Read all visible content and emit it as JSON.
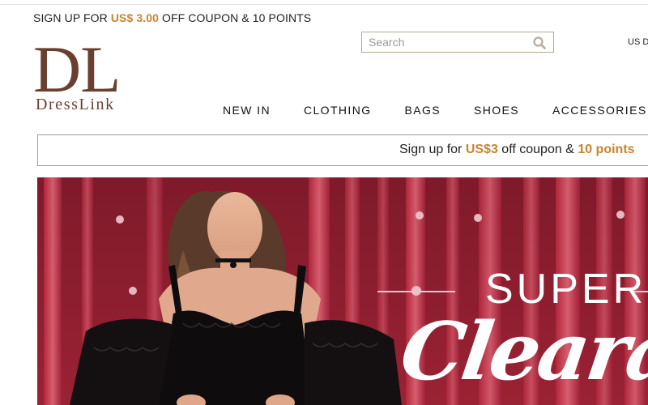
{
  "promo_top": {
    "prefix": "SIGN UP FOR ",
    "amount": "US$ 3.00",
    "suffix": " OFF COUPON & 10 POINTS"
  },
  "logo": {
    "mark": "DL",
    "name": "DressLink"
  },
  "search": {
    "placeholder": "Search",
    "icon": "magnifier-icon"
  },
  "currency": {
    "label": "US D"
  },
  "nav": {
    "items": [
      {
        "label": "NEW IN"
      },
      {
        "label": "CLOTHING"
      },
      {
        "label": "BAGS"
      },
      {
        "label": "SHOES"
      },
      {
        "label": "ACCESSORIES"
      }
    ]
  },
  "signup_bar": {
    "t1": "Sign up for ",
    "amount": "US$3",
    "t2": " off coupon & ",
    "points": "10 points"
  },
  "banner": {
    "line1": "SUPER",
    "line2": "Clearanc"
  },
  "colors": {
    "brand": "#6b3f30",
    "accent": "#c8842f",
    "banner_bg": "#8c1c2d"
  }
}
